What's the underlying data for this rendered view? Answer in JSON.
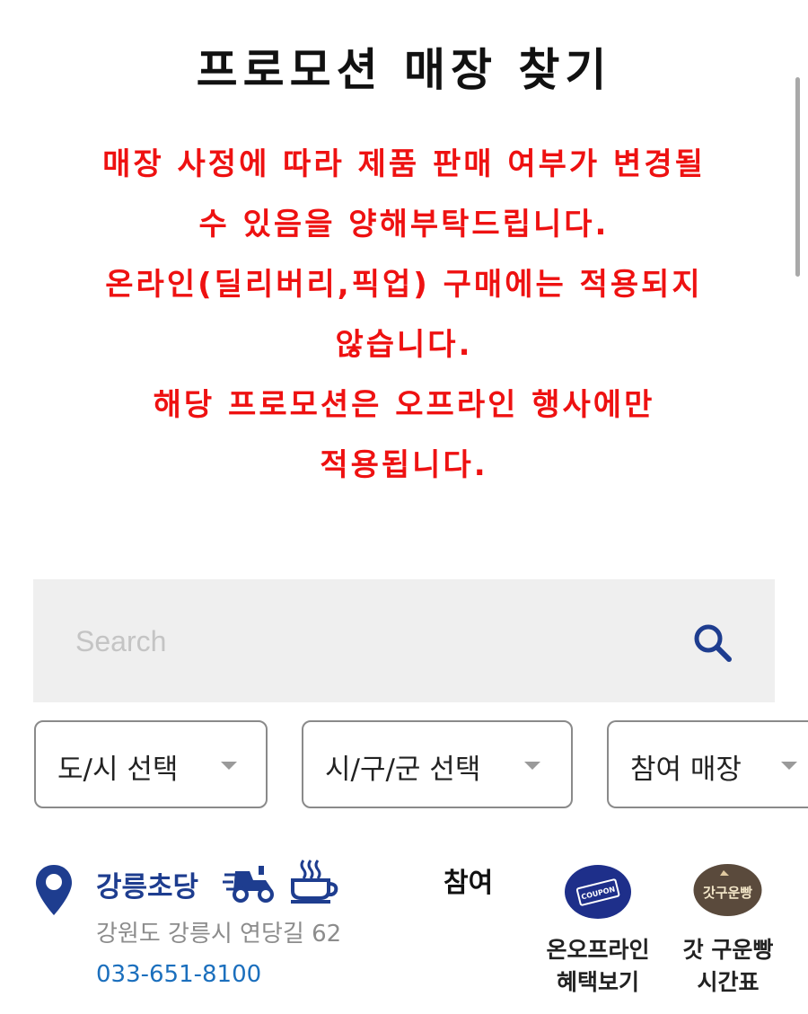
{
  "header": {
    "title": "프로모션 매장 찾기"
  },
  "notice": {
    "lines": [
      "매장 사정에 따라 제품 판매 여부가 변경될",
      "수 있음을 양해부탁드립니다.",
      "온라인(딜리버리,픽업) 구매에는 적용되지",
      "않습니다.",
      "해당 프로모션은 오프라인 행사에만",
      "적용됩니다."
    ],
    "color": "#ee1111"
  },
  "search": {
    "placeholder": "Search",
    "value": ""
  },
  "filters": [
    {
      "label": "도/시 선택"
    },
    {
      "label": "시/구/군 선택"
    },
    {
      "label": "참여 매장"
    }
  ],
  "store": {
    "name": "강릉초당",
    "address": "강원도 강릉시 연당길 62",
    "phone": "033-651-8100",
    "participation": "참여",
    "services": [
      "delivery-icon",
      "coffee-icon"
    ],
    "coupon": {
      "badge_text": "COUPON",
      "label_line1": "온오프라인",
      "label_line2": "혜택보기"
    },
    "gat_bread": {
      "badge_text": "갓구운빵",
      "label_line1": "갓 구운빵",
      "label_line2": "시간표"
    }
  },
  "colors": {
    "brand_blue": "#1e3d8f",
    "phone_link": "#1b6fbd",
    "coupon_bg": "#1e2f8a",
    "gat_bg": "#5a4a3c"
  }
}
